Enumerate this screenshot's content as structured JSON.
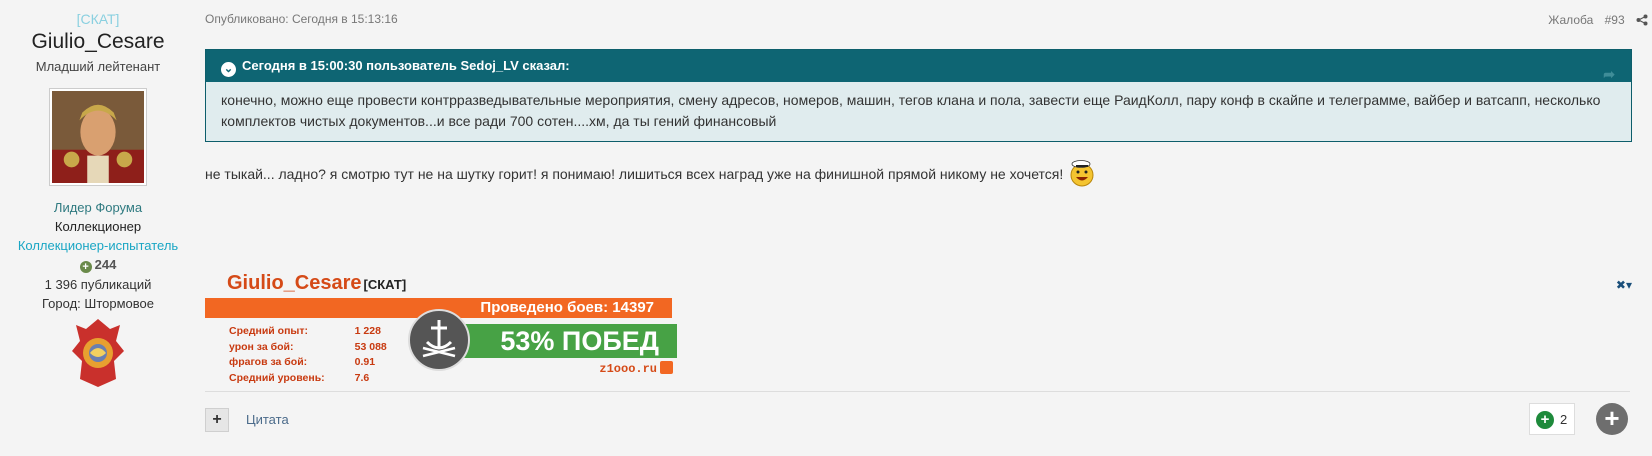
{
  "author": {
    "clan": "[СКАТ]",
    "name": "Giulio_Cesare",
    "rank": "Младший лейтенант",
    "role1": "Лидер Форума",
    "role2": "Коллекционер",
    "role3": "Коллекционер-испытатель",
    "reputation": "244",
    "posts": "1 396 публикаций",
    "city": "Город: Штормовое"
  },
  "post": {
    "published": "Опубликовано: Сегодня в 15:13:16",
    "report": "Жалоба",
    "number": "#93",
    "quote_header": "Сегодня в 15:00:30 пользователь Sedoj_LV сказал:",
    "quote_text": "конечно, можно еще провести контрразведывательные мероприятия, смену адресов, номеров, машин, тегов клана и пола, завести еще РаидКолл, пару конф в скайпе и телеграмме, вайбер и ватсапп, несколько комплектов чистых документов...и все ради 700 сотен....хм, да ты гений финансовый",
    "message": "не тыкай... ладно? я смотрю тут не на шутку горит! я понимаю! лишиться всех наград  уже на финишной прямой никому не хочется!"
  },
  "signature": {
    "name": "Giulio_Cesare",
    "clan": "[СКАТ]",
    "battles": "Проведено боев: 14397",
    "stats": [
      {
        "label": "Средний опыт:",
        "value": "1 228"
      },
      {
        "label": "урон за бой:",
        "value": "53 088"
      },
      {
        "label": "фрагов за бой:",
        "value": "0.91"
      },
      {
        "label": "Средний уровень:",
        "value": "7.6"
      }
    ],
    "winrate": "53% ПОБЕД",
    "site": "z1ooo.ru"
  },
  "actions": {
    "quote": "Цитата",
    "reactions_count": "2"
  }
}
